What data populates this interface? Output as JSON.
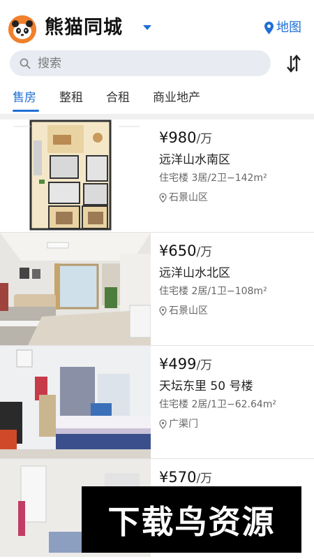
{
  "header": {
    "title": "熊猫同城",
    "map_label": "地图"
  },
  "search": {
    "placeholder": "搜索"
  },
  "tabs": [
    {
      "label": "售房",
      "active": true
    },
    {
      "label": "整租",
      "active": false
    },
    {
      "label": "合租",
      "active": false
    },
    {
      "label": "商业地产",
      "active": false
    }
  ],
  "listings": [
    {
      "price": "¥980",
      "unit": "/万",
      "name": "远洋山水南区",
      "detail": "住宅楼 3居/2卫−142m²",
      "district": "石景山区"
    },
    {
      "price": "¥650",
      "unit": "/万",
      "name": "远洋山水北区",
      "detail": "住宅楼 2居/1卫−108m²",
      "district": "石景山区"
    },
    {
      "price": "¥499",
      "unit": "/万",
      "name": "天坛东里 50 号楼",
      "detail": "住宅楼 2居/1卫−62.64m²",
      "district": "广渠门"
    },
    {
      "price": "¥570",
      "unit": "/万",
      "name": "",
      "detail": "",
      "district": ""
    }
  ],
  "watermark": {
    "text": "下载鸟资源"
  },
  "colors": {
    "accent": "#1f6fd6",
    "logo_bg": "#f0802c",
    "search_bg": "#e8ecf2"
  }
}
